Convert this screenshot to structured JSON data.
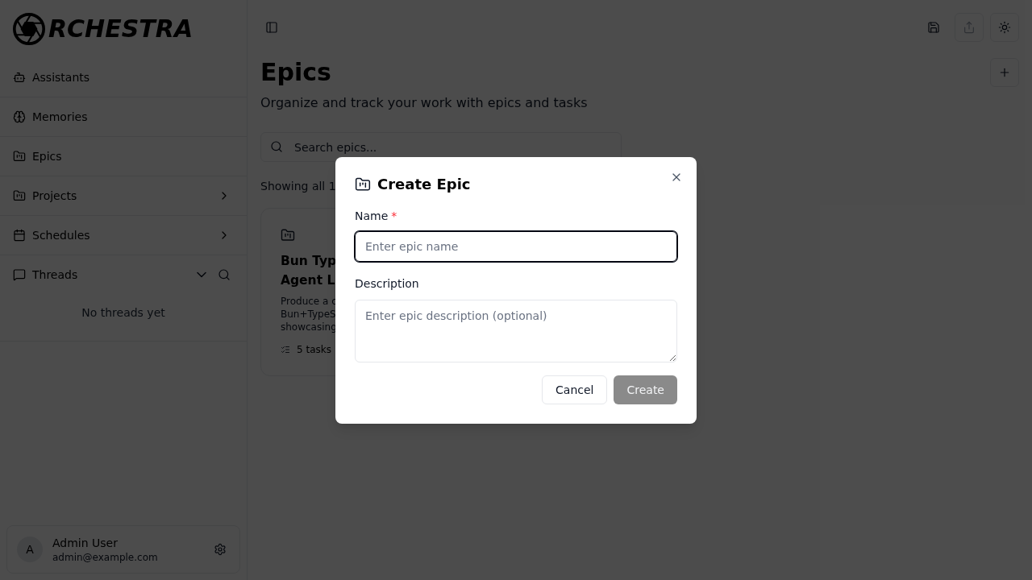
{
  "sidebar": {
    "logo": {
      "text": "RCHESTRA"
    },
    "nav_items": [
      {
        "label": "Assistants",
        "kind": "link"
      },
      {
        "label": "Memories",
        "kind": "link"
      },
      {
        "label": "Epics",
        "kind": "link"
      },
      {
        "label": "Projects",
        "kind": "group",
        "expanded": false
      },
      {
        "label": "Schedules",
        "kind": "group",
        "expanded": false
      },
      {
        "label": "Threads",
        "kind": "section",
        "expanded": true
      }
    ],
    "threads_empty": "No threads yet",
    "user": {
      "initial": "A",
      "name": "Admin User",
      "email": "admin@example.com"
    }
  },
  "page": {
    "title": "Epics",
    "subtitle": "Organize and track your work with epics and tasks",
    "search": {
      "placeholder": "Search epics..."
    },
    "count_text": "Showing all 1",
    "epic_cards": [
      {
        "title_lines": [
          "Bun Typ",
          "Agent L"
        ],
        "description_lines": [
          "Produce a c",
          "Bun+TypeS",
          "showcasing"
        ],
        "task_count": "5 tasks"
      }
    ]
  },
  "dialog": {
    "title": "Create Epic",
    "fields": [
      {
        "label": "Name",
        "required_mark": "*",
        "kind": "input",
        "placeholder": "Enter epic name",
        "focused": true
      },
      {
        "label": "Description",
        "kind": "textarea",
        "placeholder": "Enter epic description (optional)",
        "focused": false
      }
    ],
    "buttons": [
      {
        "label": "Cancel",
        "kind": "secondary",
        "disabled": false
      },
      {
        "label": "Create",
        "kind": "primary",
        "disabled": true
      }
    ]
  }
}
